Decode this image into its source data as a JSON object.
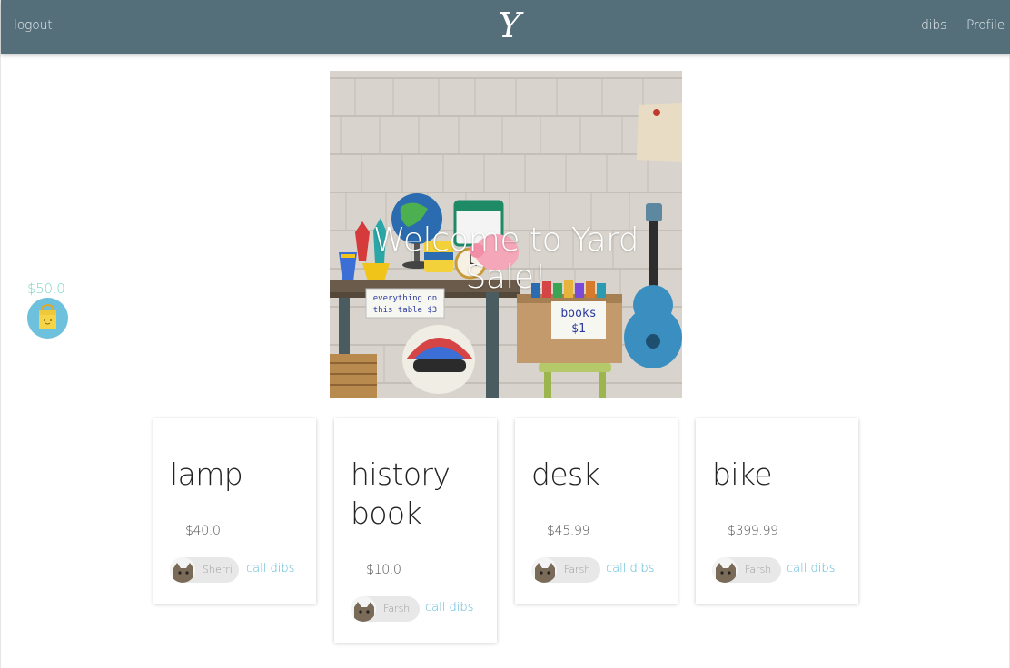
{
  "navbar": {
    "logout_label": "logout",
    "brand": "Y",
    "dibs_label": "dibs",
    "profile_label": "Profile"
  },
  "hero": {
    "title": "Welcome to Yard Sale!",
    "sign_table": "everything on this table $3",
    "sign_books": "books $1"
  },
  "wallet": {
    "amount": "$50.0",
    "icon": "bag-icon"
  },
  "items": [
    {
      "title": "lamp",
      "price": "$40.0",
      "seller": "Sherri",
      "action": "call dibs"
    },
    {
      "title_line1": "history",
      "title_line2": "book",
      "price": "$10.0",
      "seller": "Farsh",
      "action": "call dibs"
    },
    {
      "title": "desk",
      "price": "$45.99",
      "seller": "Farsh",
      "action": "call dibs"
    },
    {
      "title": "bike",
      "price": "$399.99",
      "seller": "Farsh",
      "action": "call dibs"
    }
  ],
  "colors": {
    "navbar": "#546e7a",
    "accent_link": "#5bb7d6",
    "wallet_amount": "#7ed6c5",
    "wallet_avatar": "#6ec1dc"
  }
}
